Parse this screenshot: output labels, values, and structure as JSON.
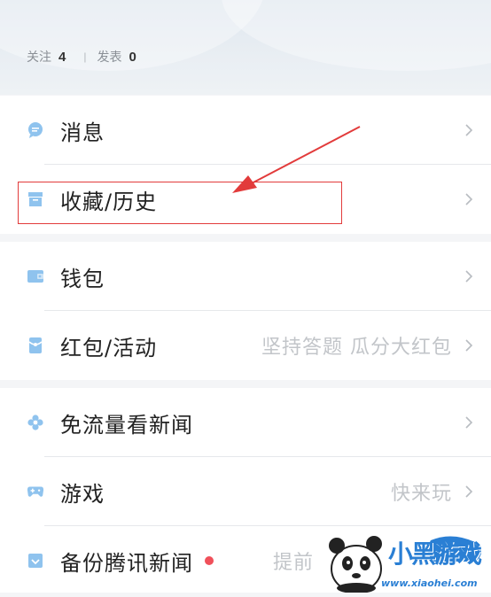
{
  "profile": {
    "follow_label": "关注",
    "follow_count": "4",
    "posts_label": "发表",
    "posts_count": "0"
  },
  "menu": {
    "group1": [
      {
        "label": "消息",
        "icon": "message-bubble-icon"
      },
      {
        "label": "收藏/历史",
        "icon": "archive-box-icon"
      }
    ],
    "group2": [
      {
        "label": "钱包",
        "icon": "wallet-icon"
      },
      {
        "label": "红包/活动",
        "icon": "red-packet-icon",
        "hint": "坚持答题 瓜分大红包"
      }
    ],
    "group3": [
      {
        "label": "免流量看新闻",
        "icon": "flower-icon"
      },
      {
        "label": "游戏",
        "icon": "gamepad-icon",
        "hint": "快来玩"
      },
      {
        "label": "备份腾讯新闻",
        "icon": "backup-box-icon",
        "hint": "提前"
      }
    ]
  },
  "watermark": {
    "brand": "小黑游戏",
    "url": "www.xiaohei.com"
  },
  "colors": {
    "icon_blue": "#8fc3ee",
    "highlight_red": "#e23b3b",
    "badge_red": "#f0505a",
    "watermark_blue": "#2a7fd4"
  }
}
